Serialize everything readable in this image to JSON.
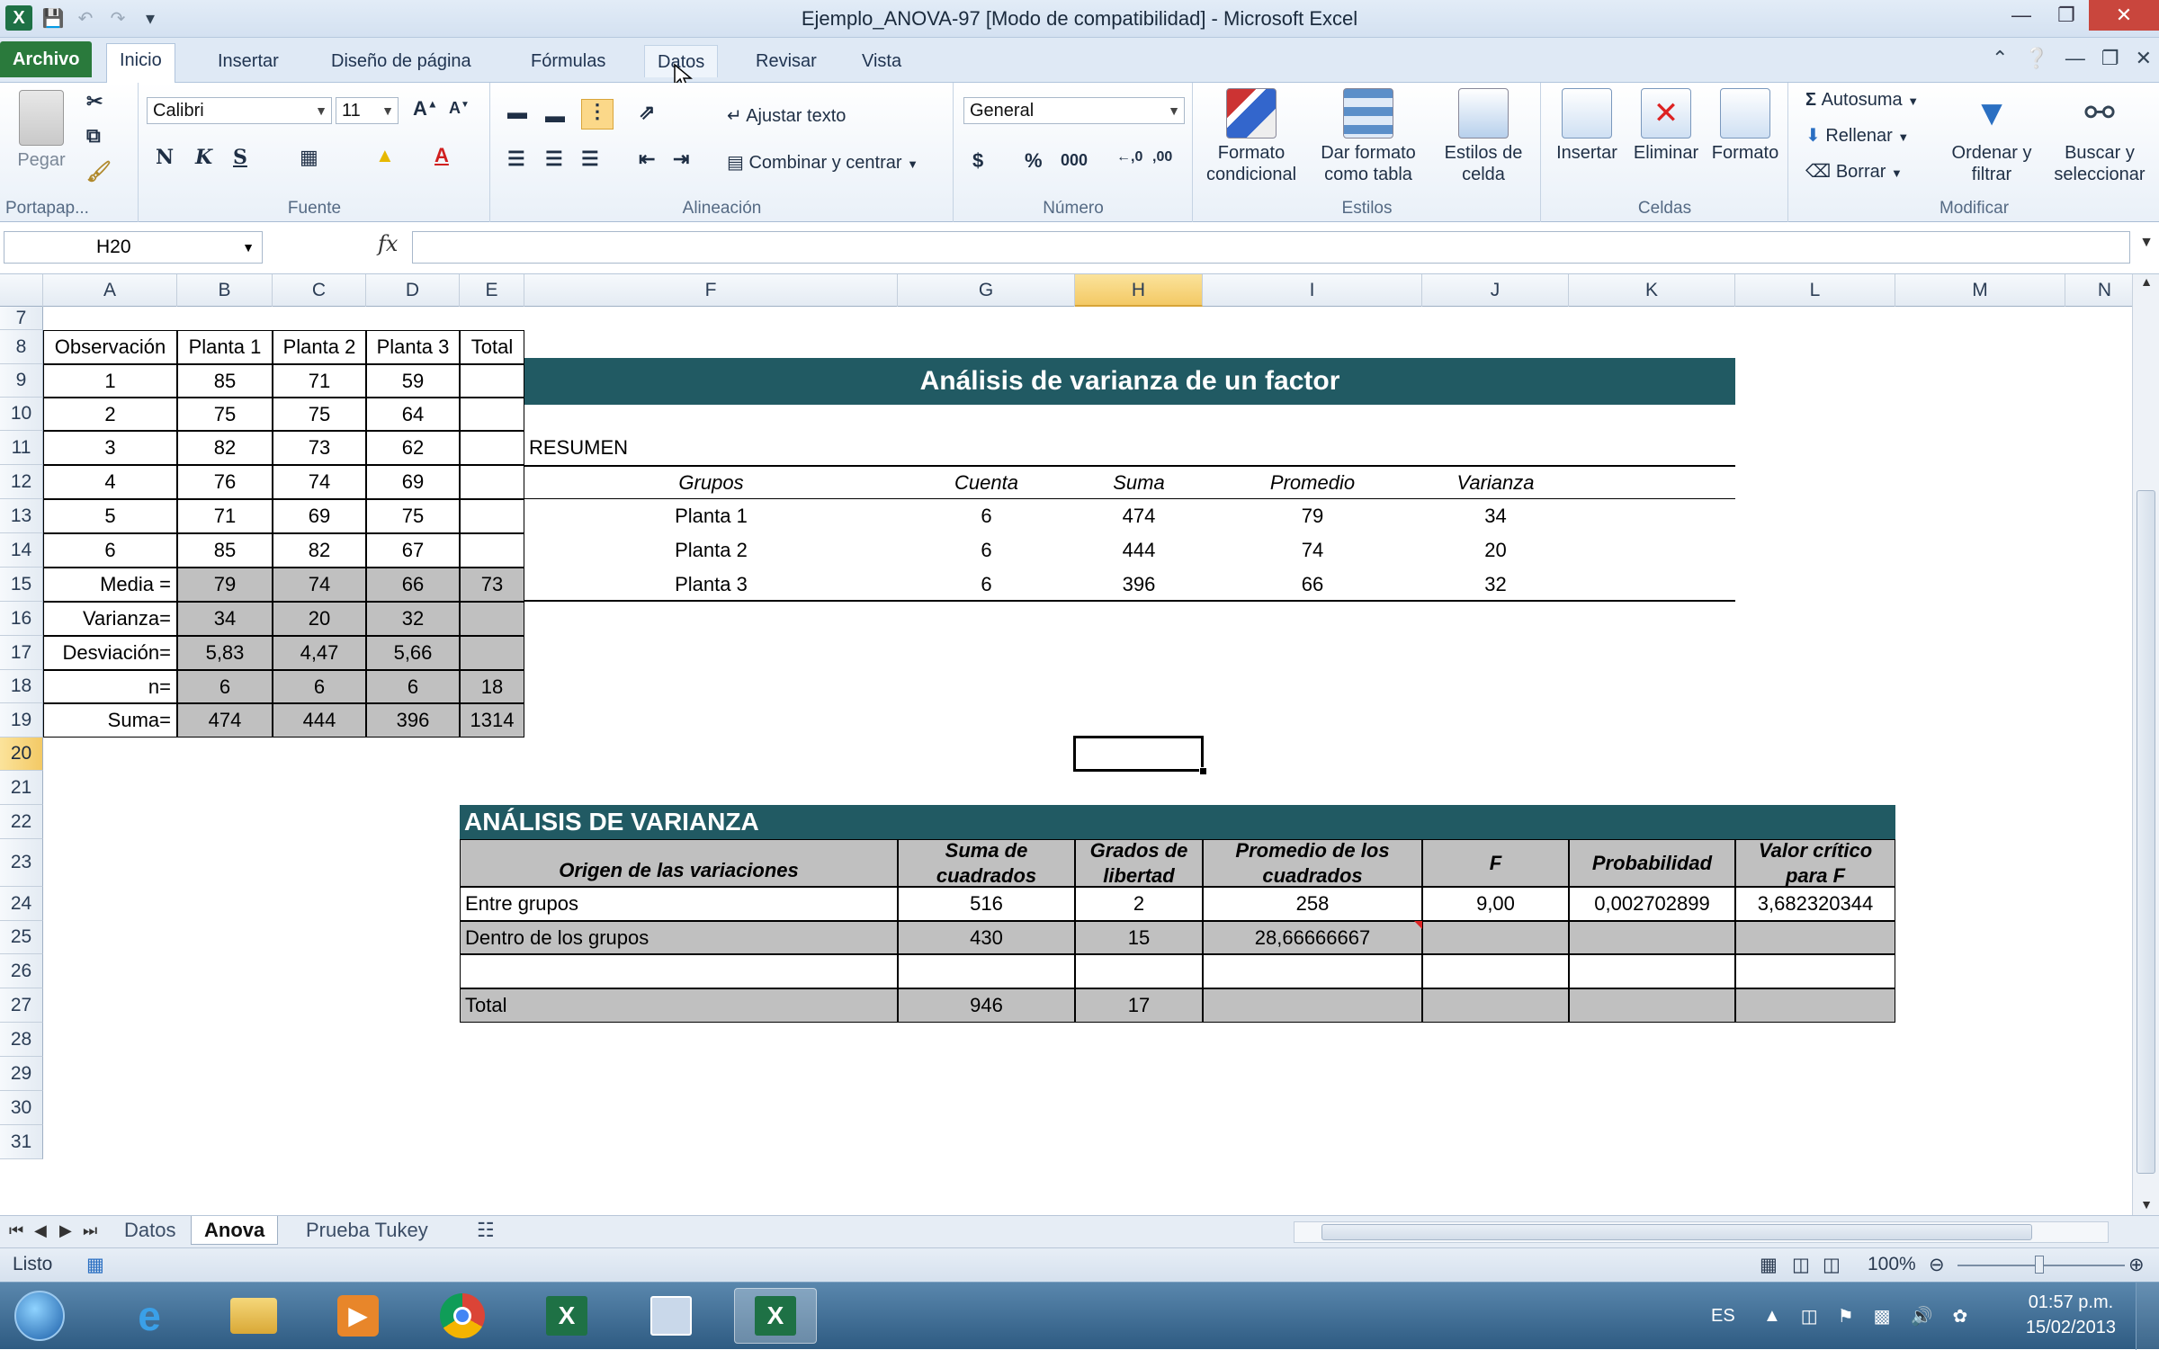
{
  "window": {
    "title": "Ejemplo_ANOVA-97  [Modo de compatibilidad]  -  Microsoft Excel"
  },
  "ribbon_tabs": [
    "Archivo",
    "Inicio",
    "Insertar",
    "Diseño de página",
    "Fórmulas",
    "Datos",
    "Revisar",
    "Vista"
  ],
  "ribbon": {
    "clipboard": {
      "paste": "Pegar",
      "label": "Portapap..."
    },
    "font": {
      "name": "Calibri",
      "size": "11",
      "bold": "N",
      "italic": "K",
      "underline": "S",
      "label": "Fuente"
    },
    "alignment": {
      "wrap": "Ajustar texto",
      "merge": "Combinar y centrar",
      "label": "Alineación"
    },
    "number": {
      "format": "General",
      "currency": "$",
      "percent": "%",
      "thousands": "000",
      "label": "Número"
    },
    "styles": {
      "cond": "Formato condicional",
      "table": "Dar formato como tabla",
      "cell": "Estilos de celda",
      "label": "Estilos"
    },
    "cells": {
      "insert": "Insertar",
      "delete": "Eliminar",
      "format": "Formato",
      "label": "Celdas"
    },
    "edit": {
      "autosum": "Autosuma",
      "fill": "Rellenar",
      "clear": "Borrar",
      "sort": "Ordenar y filtrar",
      "find": "Buscar y seleccionar",
      "label": "Modificar"
    }
  },
  "formula_bar": {
    "name_box": "H20",
    "fx": "fx",
    "value": ""
  },
  "columns": [
    "A",
    "B",
    "C",
    "D",
    "E",
    "F",
    "G",
    "H",
    "I",
    "J",
    "K",
    "L",
    "M",
    "N"
  ],
  "rows": [
    "7",
    "8",
    "9",
    "10",
    "11",
    "12",
    "13",
    "14",
    "15",
    "16",
    "17",
    "18",
    "19",
    "20",
    "21",
    "22",
    "23",
    "24",
    "25",
    "26",
    "27",
    "28",
    "29",
    "30",
    "31"
  ],
  "selected": {
    "cell": "H20",
    "column": "H",
    "row": "20"
  },
  "left_table": {
    "headers": [
      "Observación",
      "Planta 1",
      "Planta 2",
      "Planta 3",
      "Total"
    ],
    "observations": [
      [
        "1",
        "85",
        "71",
        "59",
        ""
      ],
      [
        "2",
        "75",
        "75",
        "64",
        ""
      ],
      [
        "3",
        "82",
        "73",
        "62",
        ""
      ],
      [
        "4",
        "76",
        "74",
        "69",
        ""
      ],
      [
        "5",
        "71",
        "69",
        "75",
        ""
      ],
      [
        "6",
        "85",
        "82",
        "67",
        ""
      ]
    ],
    "stats": [
      [
        "Media =",
        "79",
        "74",
        "66",
        "73"
      ],
      [
        "Varianza=",
        "34",
        "20",
        "32",
        ""
      ],
      [
        "Desviación=",
        "5,83",
        "4,47",
        "5,66",
        ""
      ],
      [
        "n=",
        "6",
        "6",
        "6",
        "18"
      ],
      [
        "Suma=",
        "474",
        "444",
        "396",
        "1314"
      ]
    ]
  },
  "summary": {
    "title": "Análisis de varianza de un factor",
    "label": "RESUMEN",
    "headers": [
      "Grupos",
      "Cuenta",
      "Suma",
      "Promedio",
      "Varianza"
    ],
    "rows": [
      [
        "Planta 1",
        "6",
        "474",
        "79",
        "34"
      ],
      [
        "Planta 2",
        "6",
        "444",
        "74",
        "20"
      ],
      [
        "Planta 3",
        "6",
        "396",
        "66",
        "32"
      ]
    ]
  },
  "anova": {
    "title": "ANÁLISIS DE VARIANZA",
    "headers": {
      "origin": "Origen de las variaciones",
      "ss": [
        "Suma de",
        "cuadrados"
      ],
      "df": [
        "Grados de",
        "libertad"
      ],
      "ms": [
        "Promedio de los",
        "cuadrados"
      ],
      "f": "F",
      "p": "Probabilidad",
      "crit": [
        "Valor crítico",
        "para F"
      ]
    },
    "rows": [
      [
        "Entre grupos",
        "516",
        "2",
        "258",
        "9,00",
        "0,002702899",
        "3,682320344"
      ],
      [
        "Dentro de los grupos",
        "430",
        "15",
        "28,66666667",
        "",
        "",
        ""
      ],
      [
        "",
        "",
        "",
        "",
        "",
        "",
        ""
      ],
      [
        "Total",
        "946",
        "17",
        "",
        "",
        "",
        ""
      ]
    ]
  },
  "sheets": [
    "Datos",
    "Anova",
    "Prueba Tukey"
  ],
  "active_sheet": "Anova",
  "status": {
    "ready": "Listo",
    "zoom": "100%"
  },
  "taskbar": {
    "lang": "ES",
    "time": "01:57 p.m.",
    "date": "15/02/2013"
  }
}
